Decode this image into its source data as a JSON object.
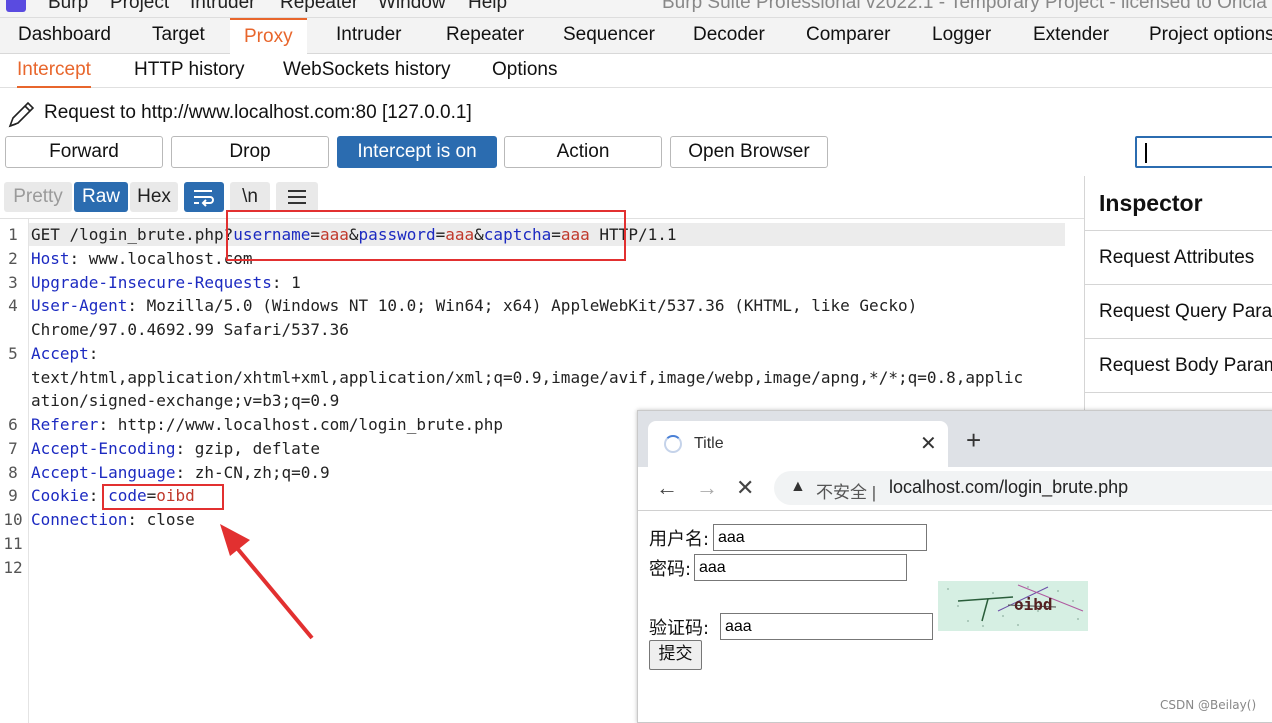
{
  "menubar": {
    "items": [
      "Burp",
      "Project",
      "Intruder",
      "Repeater",
      "Window",
      "Help"
    ],
    "app_title": "Burp Suite Professional v2022.1 - Temporary Project - licensed to Oricia"
  },
  "main_tabs": [
    "Dashboard",
    "Target",
    "Proxy",
    "Intruder",
    "Repeater",
    "Sequencer",
    "Decoder",
    "Comparer",
    "Logger",
    "Extender",
    "Project options"
  ],
  "sub_tabs": [
    "Intercept",
    "HTTP history",
    "WebSockets history",
    "Options"
  ],
  "request_to": "Request to http://www.localhost.com:80  [127.0.0.1]",
  "toolbar": {
    "forward": "Forward",
    "drop": "Drop",
    "intercept": "Intercept is on",
    "action": "Action",
    "open_browser": "Open Browser"
  },
  "view_tabs": {
    "pretty": "Pretty",
    "raw": "Raw",
    "hex": "Hex",
    "newline": "\\n"
  },
  "request": {
    "line_numbers": [
      "1",
      "2",
      "3",
      "4",
      "5",
      "6",
      "7",
      "8",
      "9",
      "10",
      "11",
      "12"
    ],
    "l1_prefix": "GET /login_brute.php?",
    "l1_k1": "username",
    "l1_v1": "aaa",
    "l1_k2": "password",
    "l1_v2": "aaa",
    "l1_k3": "captcha",
    "l1_v3": "aaa",
    "l1_suffix": " HTTP/1.1",
    "l2_key": "Host",
    "l2_val": ": www.localhost.com",
    "l3_key": "Upgrade-Insecure-Requests",
    "l3_val": ": 1",
    "l4_key": "User-Agent",
    "l4_val": ": Mozilla/5.0 (Windows NT 10.0; Win64; x64) AppleWebKit/537.36 (KHTML, like Gecko)",
    "l4_cont": "Chrome/97.0.4692.99 Safari/537.36",
    "l5_key": "Accept",
    "l5_val": ":",
    "l5_cont1": "text/html,application/xhtml+xml,application/xml;q=0.9,image/avif,image/webp,image/apng,*/*;q=0.8,applic",
    "l5_cont2": "ation/signed-exchange;v=b3;q=0.9",
    "l6_key": "Referer",
    "l6_val": ": http://www.localhost.com/login_brute.php",
    "l7_key": "Accept-Encoding",
    "l7_val": ": gzip, deflate",
    "l8_key": "Accept-Language",
    "l8_val": ": zh-CN,zh;q=0.9",
    "l9_key": "Cookie",
    "l9_colon": ": ",
    "l9_ck": "code",
    "l9_cv": "oibd",
    "l10_key": "Connection",
    "l10_val": ": close"
  },
  "inspector": {
    "title": "Inspector",
    "sections": [
      "Request Attributes",
      "Request Query Parameters",
      "Request Body Parameters"
    ]
  },
  "browser": {
    "tab_title": "Title",
    "insecure_label": "不安全 |",
    "url": "localhost.com/login_brute.php",
    "form": {
      "username_label": "用户名:",
      "username_value": "aaa",
      "password_label": "密码:",
      "password_value": "aaa",
      "captcha_label": "验证码:",
      "captcha_value": "aaa",
      "captcha_image_text": "oibd",
      "submit_label": "提交"
    }
  },
  "watermark": "CSDN @Beilay()",
  "colors": {
    "accent_orange": "#e8662c",
    "primary_blue": "#2b6cb0",
    "highlight_red": "#e23030",
    "header_key_blue": "#1c2ac1",
    "value_red": "#c0392b"
  }
}
